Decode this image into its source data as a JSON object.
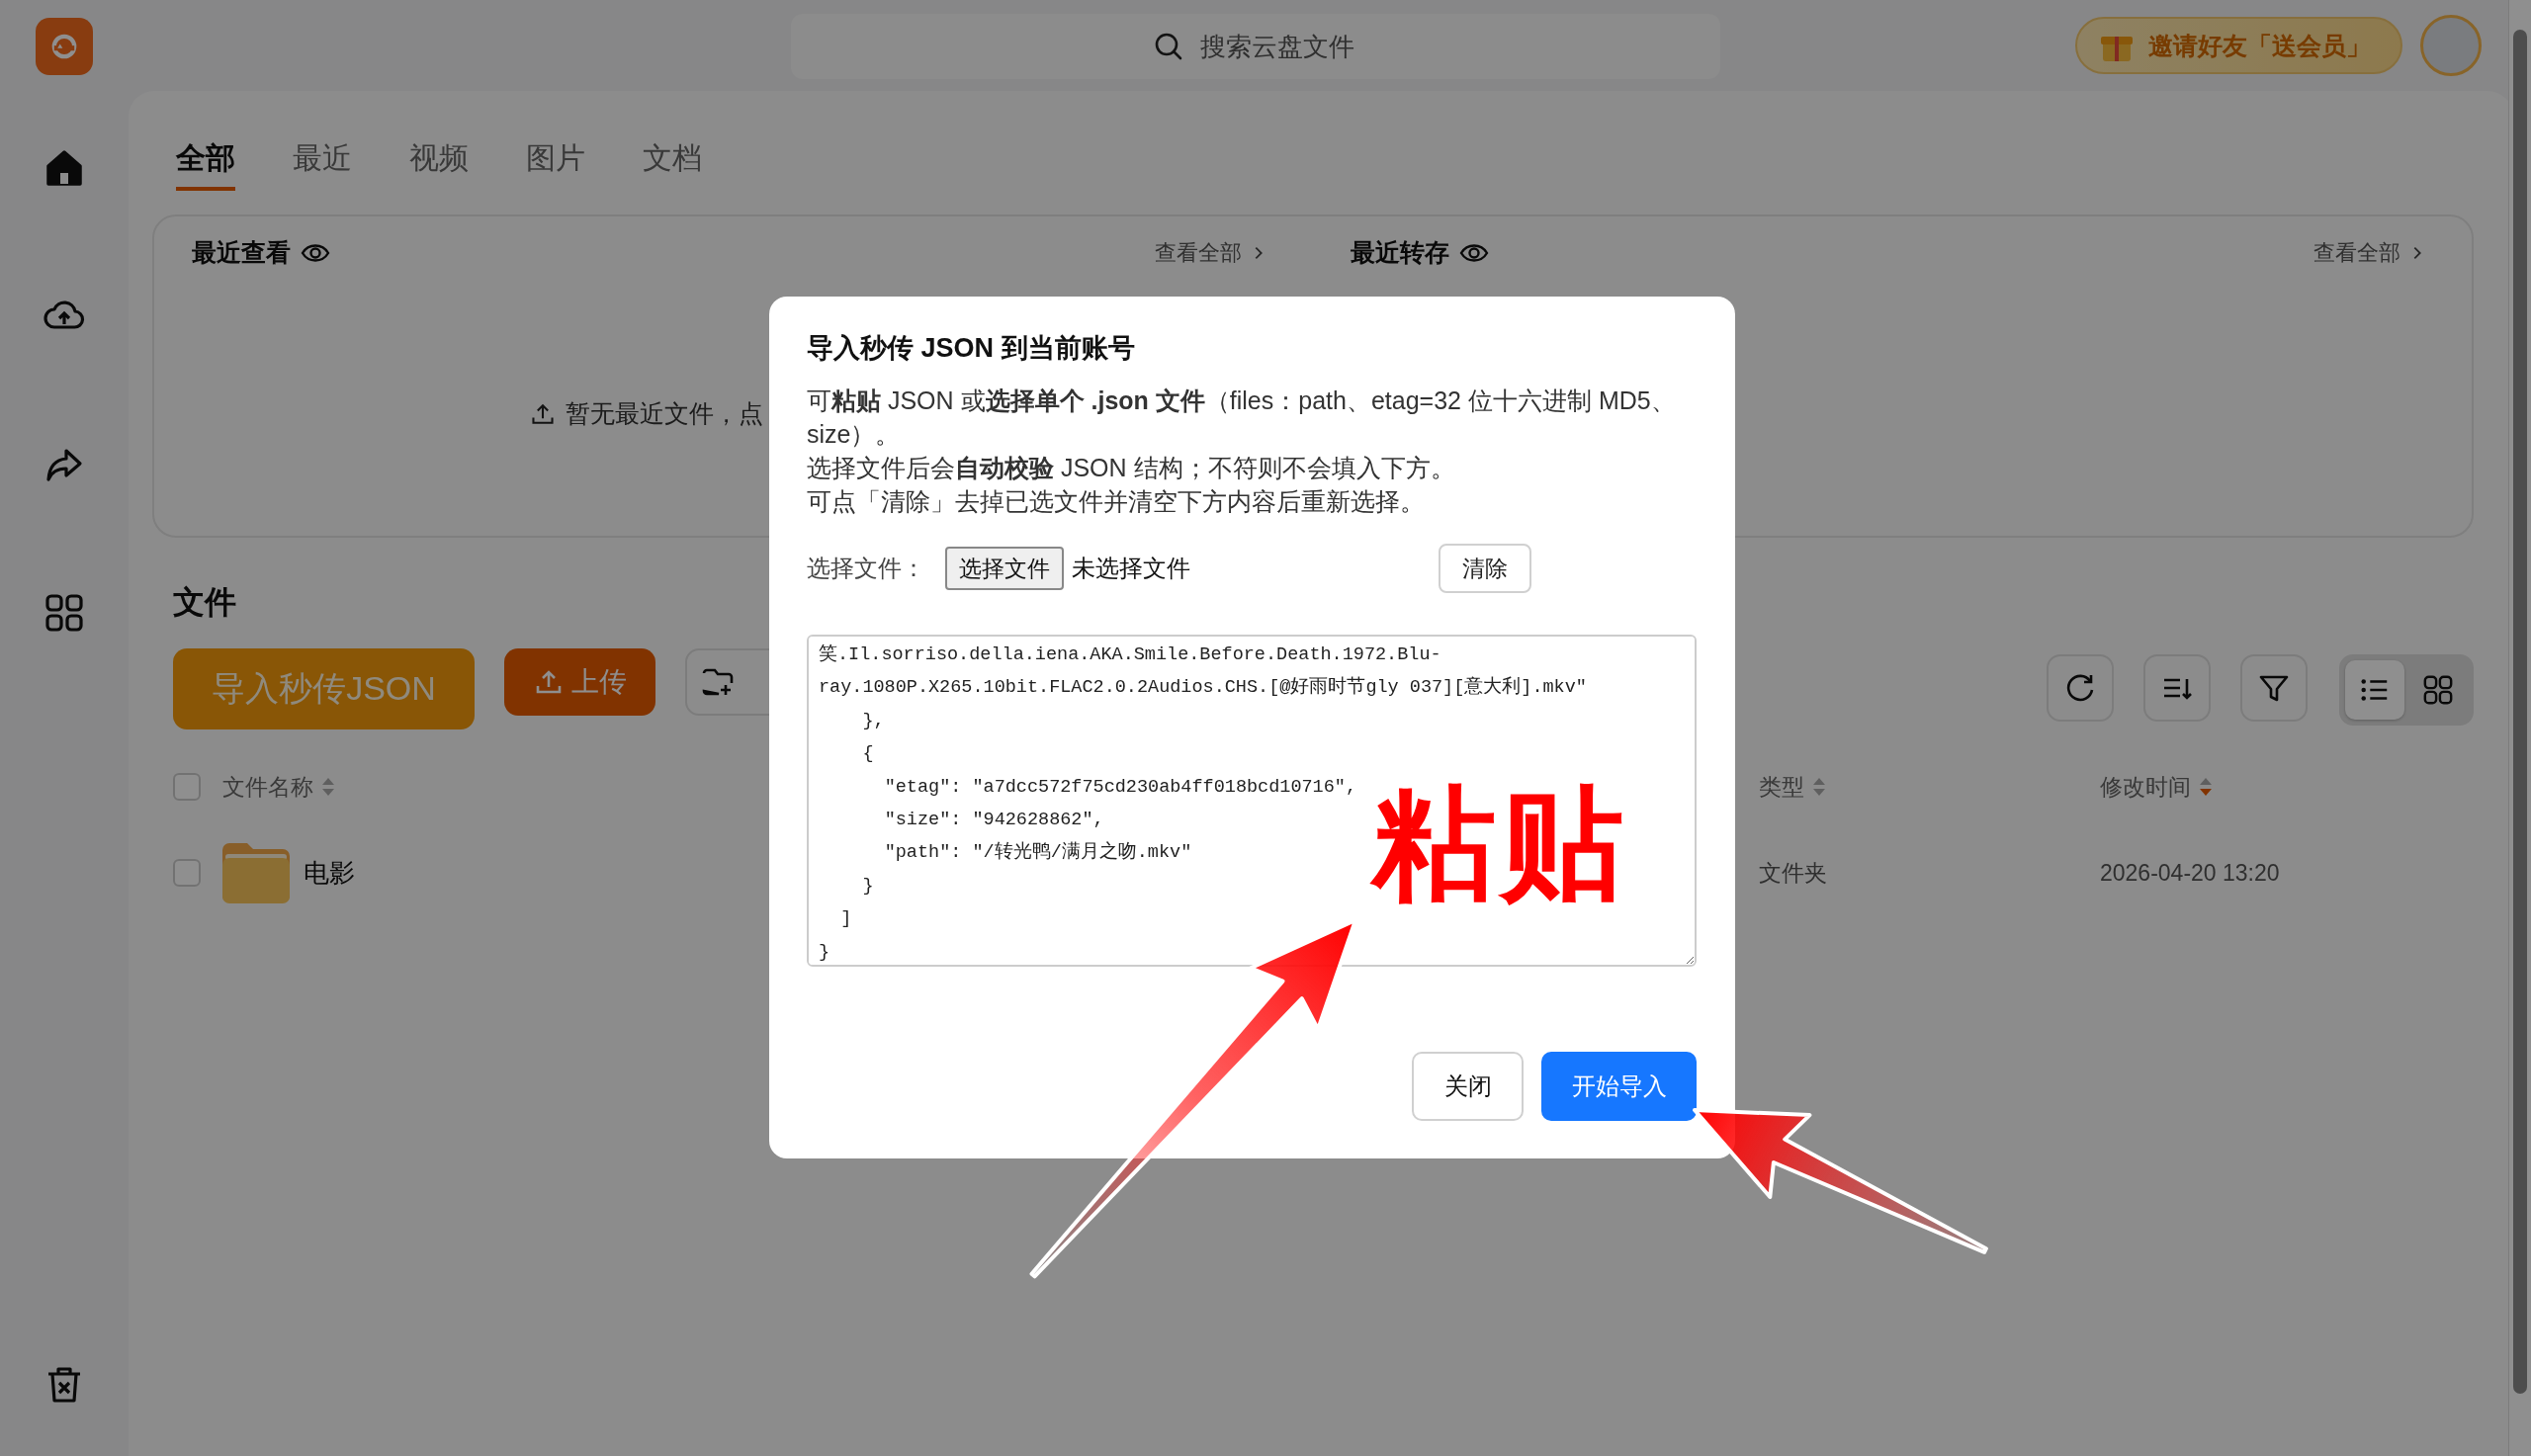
{
  "top_bar": {
    "search_placeholder": "搜索云盘文件",
    "invite": "邀请好友「送会员」"
  },
  "sidebar": {
    "items": [
      {
        "kind": "home",
        "selected": true
      },
      {
        "kind": "upload",
        "selected": false
      },
      {
        "kind": "share",
        "selected": false
      },
      {
        "kind": "apps",
        "selected": false
      }
    ],
    "bottom": [
      {
        "kind": "trash",
        "selected": false
      }
    ]
  },
  "tabs": [
    {
      "label": "全部",
      "selected": true
    },
    {
      "label": "最近",
      "selected": false
    },
    {
      "label": "视频",
      "selected": false
    },
    {
      "label": "图片",
      "selected": false
    },
    {
      "label": "文档",
      "selected": false
    }
  ],
  "recent": {
    "sections": [
      {
        "title": "最近查看",
        "link": "查看全部"
      },
      {
        "title": "最近转存",
        "link": "查看全部"
      }
    ],
    "empty": "暂无最近文件，点"
  },
  "files": {
    "heading": "文件",
    "actions": [
      {
        "kind": "import",
        "label": "导入秒传JSON"
      },
      {
        "kind": "upload",
        "label": "上传"
      },
      {
        "kind": "new_folder"
      }
    ],
    "tools": [
      {
        "kind": "refresh"
      },
      {
        "kind": "sort"
      },
      {
        "kind": "filter"
      }
    ],
    "view_modes": [
      {
        "kind": "list",
        "selected": true
      },
      {
        "kind": "grid",
        "selected": false
      }
    ]
  },
  "table": {
    "select_all": {
      "checked": false
    },
    "columns": [
      {
        "label": "文件名称",
        "sorted_desc": false
      },
      {
        "label": "类型",
        "sorted_desc": false
      },
      {
        "label": "修改时间",
        "sorted_desc": true
      }
    ],
    "rows": [
      {
        "name": "电影",
        "type": "文件夹",
        "modified": "2026-04-20 13:20",
        "checked": false
      }
    ]
  },
  "dialog": {
    "title": "导入秒传 JSON 到当前账号",
    "paragraphs": [
      "可**粘贴** JSON 或**选择单个 .json 文件**（files：path、etag=32 位十六进制 MD5、size）。",
      "选择文件后会**自动校验** JSON 结构；不符则不会填入下方。",
      "可点「清除」去掉已选文件并清空下方内容后重新选择。"
    ],
    "file_label": "选择文件：",
    "file_button": "选择文件",
    "file_status": "未选择文件",
    "clear": "清除",
    "json_text": "笑.Il.sorriso.della.iena.AKA.Smile.Before.Death.1972.Blu-ray.1080P.X265.10bit.FLAC2.0.2Audios.CHS.[@好雨时节gly 037][意大利].mkv\"\n    },\n    {\n      \"etag\": \"a7dcc572f75cd230ab4ff018bcd10716\",\n      \"size\": \"942628862\",\n      \"path\": \"/转光鸭/满月之吻.mkv\"\n    }\n  ]\n}",
    "buttons": [
      {
        "kind": "secondary",
        "label": "关闭"
      },
      {
        "kind": "primary",
        "label": "开始导入"
      }
    ]
  },
  "annotation": {
    "text": "粘贴"
  }
}
